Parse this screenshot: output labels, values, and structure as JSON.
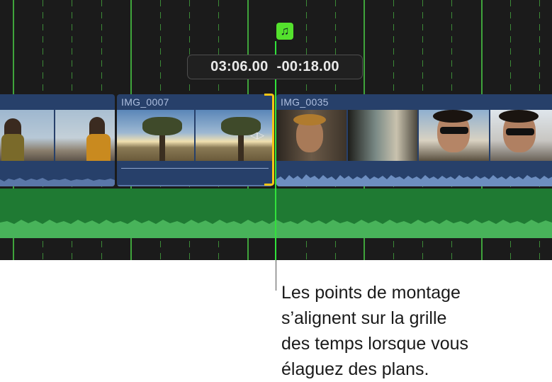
{
  "timeline": {
    "tooltip_time": "03:06.00",
    "tooltip_delta": "-00:18.00",
    "marker_glyph": "♫",
    "clips": [
      {
        "name": ""
      },
      {
        "name": "IMG_0007"
      },
      {
        "name": "IMG_0035"
      }
    ]
  },
  "callout": {
    "lines": [
      "Les points de montage",
      "s’alignent sur la grille",
      "des temps lorsque vous",
      "élaguez des plans."
    ]
  },
  "colors": {
    "timeline_bg": "#1b1b1b",
    "grid_line": "#3fa43b",
    "clip_blue": "#27406a",
    "music_lane": "#1f7a33",
    "trim_handle": "#f7c515",
    "playhead": "#31e33b",
    "marker": "#54e12d"
  }
}
